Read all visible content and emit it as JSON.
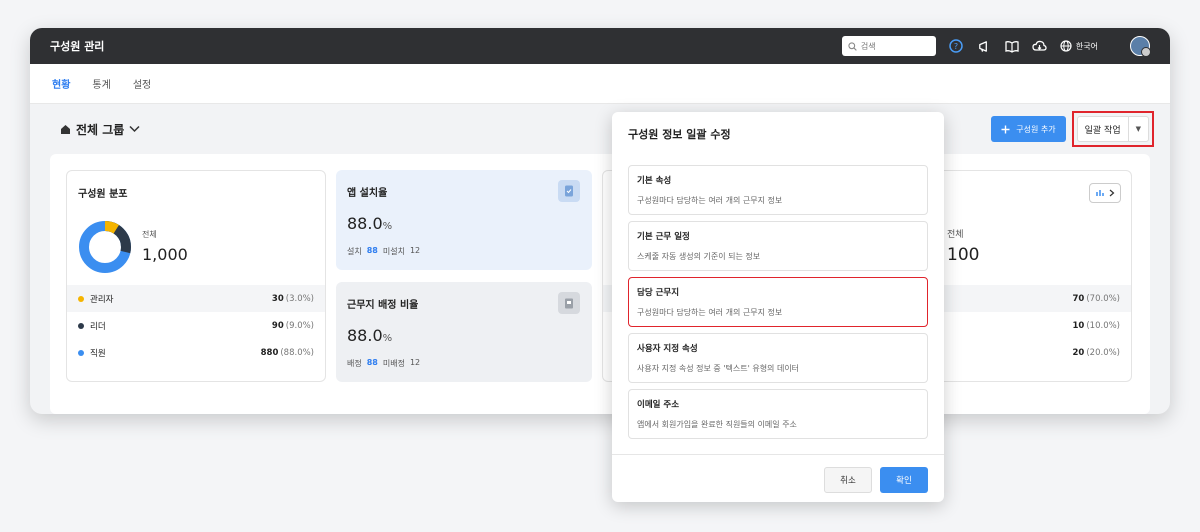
{
  "app": {
    "title": "구성원 관리"
  },
  "header": {
    "search_placeholder": "검색",
    "language": "한국어"
  },
  "tabs": [
    {
      "label": "현황"
    },
    {
      "label": "통계"
    },
    {
      "label": "설정"
    }
  ],
  "toolbar": {
    "group_label": "전체 그룹",
    "add_member": "구성원 추가",
    "bulk_action": "일괄 작업"
  },
  "distribution": {
    "title": "구성원 분포",
    "total_label": "전체",
    "total_value": "1,000",
    "rows": [
      {
        "label": "관리자",
        "count": "30",
        "percent": "(3.0%)",
        "color": "#f5b400"
      },
      {
        "label": "리더",
        "count": "90",
        "percent": "(9.0%)",
        "color": "#2d3a4a"
      },
      {
        "label": "직원",
        "count": "880",
        "percent": "(88.0%)",
        "color": "#3b8ef0"
      }
    ]
  },
  "app_install": {
    "title": "앱 설치율",
    "value": "88.0",
    "unit": "%",
    "installed_label": "설치",
    "installed_value": "88",
    "not_installed_label": "미설치",
    "not_installed_value": "12"
  },
  "workplace": {
    "title": "근무지 배정 비율",
    "value": "88.0",
    "unit": "%",
    "assigned_label": "배정",
    "assigned_value": "88",
    "unassigned_label": "미배정",
    "unassigned_value": "12"
  },
  "right_card": {
    "total_label": "전체",
    "total_value": "100",
    "rows": [
      {
        "count": "70",
        "percent": "(70.0%)"
      },
      {
        "count": "10",
        "percent": "(10.0%)"
      },
      {
        "count": "20",
        "percent": "(20.0%)"
      }
    ]
  },
  "modal": {
    "title": "구성원 정보 일괄 수정",
    "options": [
      {
        "title": "기본 속성",
        "desc": "구성원마다 담당하는 여러 개의 근무지 정보"
      },
      {
        "title": "기본 근무 일정",
        "desc": "스케줄 자동 생성의 기준이 되는 정보"
      },
      {
        "title": "담당 근무지",
        "desc": "구성원마다 담당하는 여러 개의 근무지 정보"
      },
      {
        "title": "사용자 지정 속성",
        "desc": "사용자 지정 속성 정보 중 '텍스트' 유형의 데이터"
      },
      {
        "title": "이메일 주소",
        "desc": "앱에서 회원가입을 완료한 직원들의 이메일 주소"
      }
    ],
    "cancel": "취소",
    "confirm": "확인"
  }
}
